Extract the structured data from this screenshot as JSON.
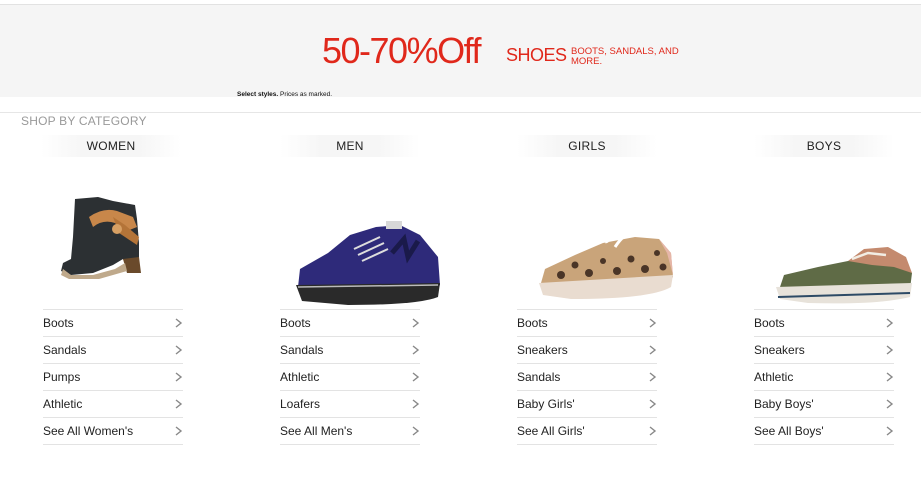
{
  "banner": {
    "headline": "50-70%Off",
    "category": "SHOES",
    "sub": "BOOTS, SANDALS, AND MORE.",
    "fine_bold": "Select styles.",
    "fine_rest": " Prices as marked."
  },
  "section_heading": "SHOP BY CATEGORY",
  "columns": [
    {
      "title": "WOMEN",
      "image": "ankle-boot-image",
      "links": [
        "Boots",
        "Sandals",
        "Pumps",
        "Athletic",
        "See All Women's"
      ]
    },
    {
      "title": "MEN",
      "image": "sneaker-image",
      "links": [
        "Boots",
        "Sandals",
        "Athletic",
        "Loafers",
        "See All Men's"
      ]
    },
    {
      "title": "GIRLS",
      "image": "leopard-sneaker-image",
      "links": [
        "Boots",
        "Sneakers",
        "Sandals",
        "Baby Girls'",
        "See All Girls'"
      ]
    },
    {
      "title": "BOYS",
      "image": "boat-shoe-image",
      "links": [
        "Boots",
        "Sneakers",
        "Athletic",
        "Baby Boys'",
        "See All Boys'"
      ]
    }
  ],
  "icons": {
    "chevron": "chevron-right-icon"
  },
  "colors": {
    "promo": "#e0281b",
    "heading": "#999999",
    "divider": "#e3e3e3"
  }
}
